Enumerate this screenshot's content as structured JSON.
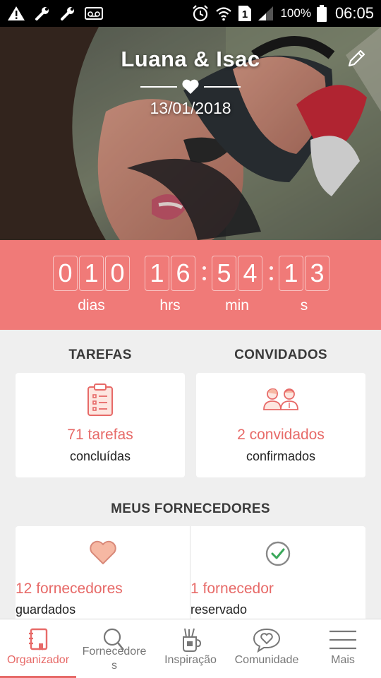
{
  "status_bar": {
    "battery_percent": "100%",
    "time": "06:05",
    "sim_slot": "1",
    "icons": [
      "warning-icon",
      "wrench-icon",
      "wrench-icon",
      "voicemail-icon",
      "alarm-icon",
      "wifi-icon",
      "sim-icon",
      "signal-icon",
      "battery-icon"
    ]
  },
  "hero": {
    "couple_names": "Luana & Isac",
    "wedding_date": "13/01/2018",
    "icons": [
      "heart-icon",
      "edit-pencil-icon"
    ]
  },
  "countdown": {
    "days": [
      "0",
      "1",
      "0"
    ],
    "hours": [
      "1",
      "6"
    ],
    "minutes": [
      "5",
      "4"
    ],
    "seconds": [
      "1",
      "3"
    ],
    "labels": {
      "days": "dias",
      "hours": "hrs",
      "minutes": "min",
      "seconds": "s"
    }
  },
  "tasks": {
    "title": "TAREFAS",
    "value": "71 tarefas",
    "sub": "concluídas",
    "icon": "clipboard-checklist-icon"
  },
  "guests": {
    "title": "CONVIDADOS",
    "value": "2 convidados",
    "sub": "confirmados",
    "icon": "guests-people-icon"
  },
  "vendors": {
    "title": "MEUS FORNECEDORES",
    "saved": {
      "value": "12 fornecedores",
      "sub": "guardados",
      "icon": "heart-icon"
    },
    "booked": {
      "value": "1 fornecedor",
      "sub": "reservado",
      "icon": "check-circle-icon"
    }
  },
  "nav": {
    "items": [
      {
        "label": "Organizador",
        "icon": "notebook-icon",
        "active": true
      },
      {
        "label": "Fornecedore s",
        "icon": "search-icon",
        "active": false
      },
      {
        "label": "Inspiração",
        "icon": "inspiration-cup-icon",
        "active": false
      },
      {
        "label": "Comunidade",
        "icon": "chat-heart-icon",
        "active": false
      },
      {
        "label": "Mais",
        "icon": "menu-icon",
        "active": false
      }
    ]
  },
  "colors": {
    "accent": "#e76a68",
    "countdown_bg": "#f07a78",
    "page_bg": "#efefef"
  }
}
